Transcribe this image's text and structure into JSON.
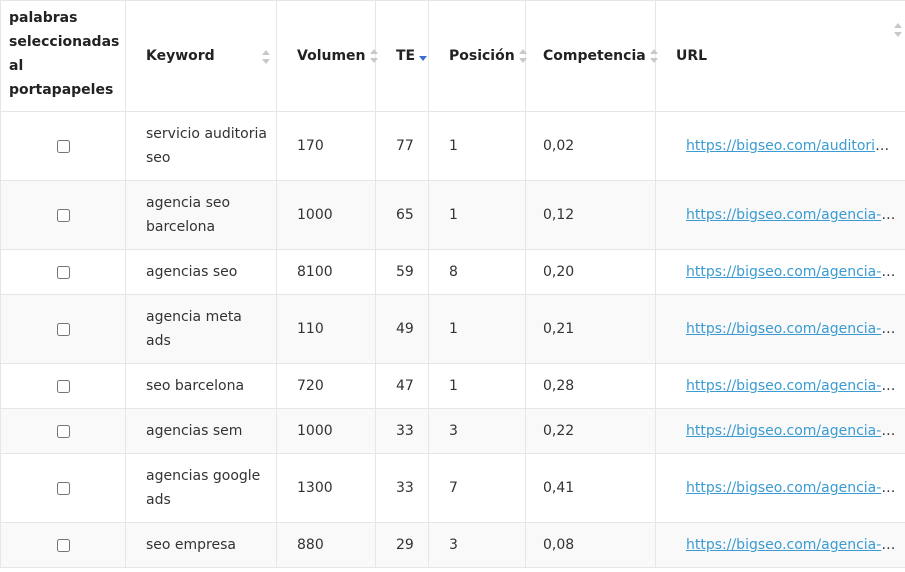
{
  "headers": {
    "copy": "palabras seleccionadas al portapapeles",
    "keyword": "Keyword",
    "volumen": "Volumen",
    "te": "TE",
    "posicion": "Posición",
    "competencia": "Competencia",
    "url": "URL"
  },
  "sort": {
    "active_column": "TE",
    "direction": "descending"
  },
  "rows": [
    {
      "keyword": "servicio auditoria seo",
      "volumen": "170",
      "te": "77",
      "posicion": "1",
      "competencia": "0,02",
      "url": "https://bigseo.com/auditoria-seo/"
    },
    {
      "keyword": "agencia seo barcelona",
      "volumen": "1000",
      "te": "65",
      "posicion": "1",
      "competencia": "0,12",
      "url": "https://bigseo.com/agencia-seo-barcelona/"
    },
    {
      "keyword": "agencias seo",
      "volumen": "8100",
      "te": "59",
      "posicion": "8",
      "competencia": "0,20",
      "url": "https://bigseo.com/agencia-seo/"
    },
    {
      "keyword": "agencia meta ads",
      "volumen": "110",
      "te": "49",
      "posicion": "1",
      "competencia": "0,21",
      "url": "https://bigseo.com/agencia-meta-ads/"
    },
    {
      "keyword": "seo barcelona",
      "volumen": "720",
      "te": "47",
      "posicion": "1",
      "competencia": "0,28",
      "url": "https://bigseo.com/agencia-seo-barcelona/"
    },
    {
      "keyword": "agencias sem",
      "volumen": "1000",
      "te": "33",
      "posicion": "3",
      "competencia": "0,22",
      "url": "https://bigseo.com/agencia-sem/"
    },
    {
      "keyword": "agencias google ads",
      "volumen": "1300",
      "te": "33",
      "posicion": "7",
      "competencia": "0,41",
      "url": "https://bigseo.com/agencia-google-ads/"
    },
    {
      "keyword": "seo empresa",
      "volumen": "880",
      "te": "29",
      "posicion": "3",
      "competencia": "0,08",
      "url": "https://bigseo.com/agencia-seo/"
    }
  ]
}
